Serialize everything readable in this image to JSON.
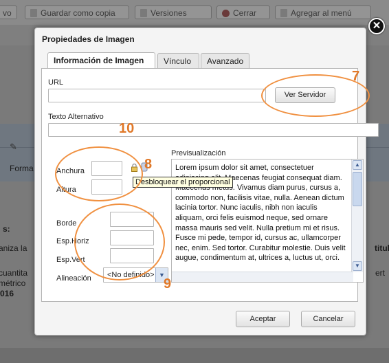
{
  "background": {
    "toolbar_buttons": [
      {
        "label": "vo"
      },
      {
        "label": "Guardar como copia"
      },
      {
        "label": "Versiones"
      },
      {
        "label": "Cerrar"
      },
      {
        "label": "Agregar al menú"
      }
    ],
    "side_texts": [
      "Forma",
      "s:",
      "aniza la",
      "cuantita",
      "métrico",
      "016"
    ],
    "right_texts": [
      "titul",
      "ert"
    ]
  },
  "dialog": {
    "title": "Propiedades de Imagen",
    "tabs": [
      "Información de Imagen",
      "Vínculo",
      "Avanzado"
    ],
    "url_label": "URL",
    "url_value": "",
    "browse_button": "Ver Servidor",
    "alt_label": "Texto Alternativo",
    "alt_value": "",
    "width_label": "Anchura",
    "height_label": "Altura",
    "width_value": "",
    "height_value": "",
    "border_label": "Borde",
    "hspace_label": "Esp.Horiz",
    "vspace_label": "Esp.Vert",
    "align_label": "Alineación",
    "align_value": "<No definido>",
    "preview_label": "Previsualización",
    "preview_text": "Lorem ipsum dolor sit amet, consectetuer adipiscing elit. Maecenas feugiat consequat diam. Maecenas metus. Vivamus diam purus, cursus a, commodo non, facilisis vitae, nulla. Aenean dictum lacinia tortor. Nunc iaculis, nibh non iaculis aliquam, orci felis euismod neque, sed ornare massa mauris sed velit. Nulla pretium mi et risus. Fusce mi pede, tempor id, cursus ac, ullamcorper nec, enim. Sed tortor. Curabitur molestie. Duis velit augue, condimentum at, ultrices a, luctus ut, orci.",
    "tooltip": "Desbloquear el proporcional",
    "ok_button": "Aceptar",
    "cancel_button": "Cancelar",
    "close_symbol": "✕"
  },
  "annotations": [
    "7",
    "10",
    "8",
    "9"
  ],
  "colors": {
    "accent": "#f09040",
    "tooltip_bg": "#ffffe1"
  }
}
